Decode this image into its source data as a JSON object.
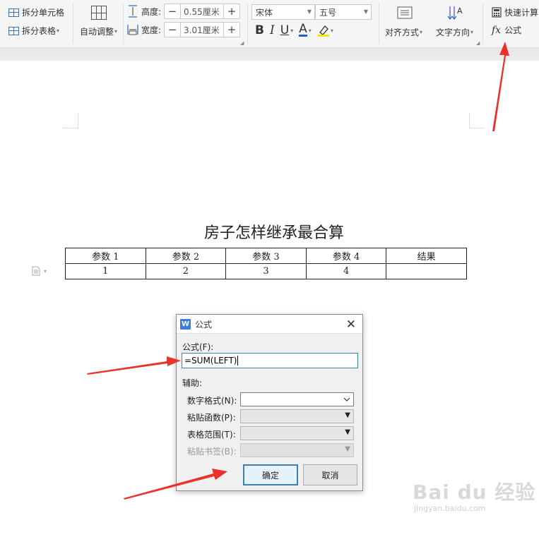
{
  "ribbon": {
    "split_cell": "拆分单元格",
    "split_table": "拆分表格",
    "auto_adjust": "自动调整",
    "height_label": "高度:",
    "height_value": "0.55厘米",
    "width_label": "宽度:",
    "width_value": "3.01厘米",
    "minus": "−",
    "plus": "+",
    "font_name": "宋体",
    "font_size": "五号",
    "bold": "B",
    "italic": "I",
    "underline": "U",
    "font_color": "A",
    "align": "对齐方式",
    "text_direction": "文字方向",
    "quick_calc": "快速计算",
    "fx": "fx",
    "formula": "公式",
    "font_color_hex": "#1e5fd6",
    "highlight_hex": "#ffe600"
  },
  "document": {
    "title": "房子怎样继承最合算",
    "table": {
      "header": [
        "参数 1",
        "参数 2",
        "参数 3",
        "参数 4",
        "结果"
      ],
      "row": [
        "1",
        "2",
        "3",
        "4",
        ""
      ]
    }
  },
  "dialog": {
    "logo": "W",
    "title": "公式",
    "formula_label": "公式(F):",
    "formula_value": "=SUM(LEFT)",
    "aux_label": "辅助:",
    "number_format": "数字格式(N):",
    "paste_function": "粘贴函数(P):",
    "table_range": "表格范围(T):",
    "paste_bookmark": "粘贴书签(B):",
    "ok": "确定",
    "cancel": "取消",
    "close": "✕"
  },
  "watermark": {
    "main": "Bai du 经验",
    "sub": "jingyan.baidu.com"
  },
  "colors": {
    "arrow": "#e8322a",
    "accent": "#3c7fb1"
  }
}
